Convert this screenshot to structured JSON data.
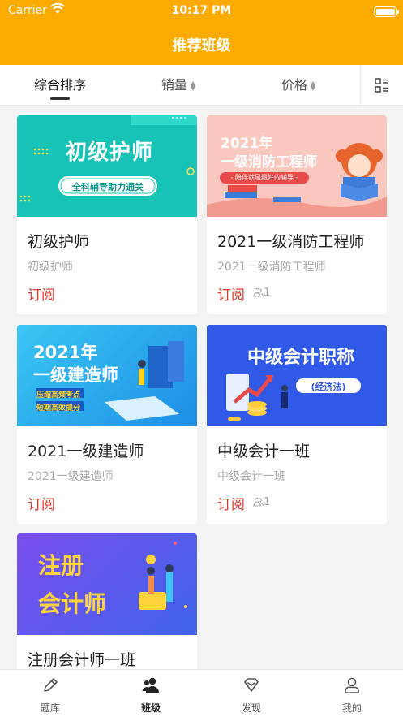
{
  "status_bar": {
    "carrier": "Carrier",
    "time": "10:17 PM"
  },
  "header": {
    "title": "推荐班级"
  },
  "filter_tabs": {
    "comprehensive": "综合排序",
    "sales": "销量",
    "price": "价格"
  },
  "courses": [
    {
      "title": "初级护师",
      "subtitle": "初级护师",
      "action": "订阅",
      "subscribers": "",
      "banner": {
        "line1": "初级护师",
        "line2": "全科辅导助力通关",
        "line3": ""
      },
      "colors": {
        "banner_bg": "#17c3b6",
        "accent": "#fde047"
      }
    },
    {
      "title": "2021一级消防工程师",
      "subtitle": "2021一级消防工程师",
      "action": "订阅",
      "subscribers": "1",
      "banner": {
        "line1": "2021年",
        "line2": "一级消防工程师",
        "line3": "- 陪伴就是最好的辅导 -"
      },
      "colors": {
        "banner_bg": "#fbc8c0",
        "accent": "#e84a4a"
      }
    },
    {
      "title": "2021一级建造师",
      "subtitle": "2021一级建造师",
      "action": "订阅",
      "subscribers": "",
      "banner": {
        "line1": "2021年",
        "line2": "一级建造师",
        "line3": "压缩高频考点",
        "line4": "短期高效提分"
      },
      "colors": {
        "banner_bg": "#2fb4ee",
        "accent": "#ffd21e"
      }
    },
    {
      "title": "中级会计一班",
      "subtitle": "中级会计一班",
      "action": "订阅",
      "subscribers": "1",
      "banner": {
        "line1": "中级会计职称",
        "line2": "(经济法)",
        "line3": ""
      },
      "colors": {
        "banner_bg": "#2f59e6",
        "accent": "#ffcc3b"
      }
    },
    {
      "title": "注册会计师一班",
      "subtitle": "",
      "action": "",
      "subscribers": "",
      "banner": {
        "line1": "注册",
        "line2": "会计师",
        "line3": ""
      },
      "colors": {
        "banner_bg": "#6a57ee",
        "accent": "#ffd43b"
      }
    }
  ],
  "bottom_nav": [
    {
      "label": "题库",
      "icon": "pencil-icon"
    },
    {
      "label": "班级",
      "icon": "class-icon"
    },
    {
      "label": "发现",
      "icon": "discover-icon"
    },
    {
      "label": "我的",
      "icon": "profile-icon"
    }
  ],
  "theme": {
    "primary": "#fbab00",
    "subscribe_red": "#e0352b"
  }
}
